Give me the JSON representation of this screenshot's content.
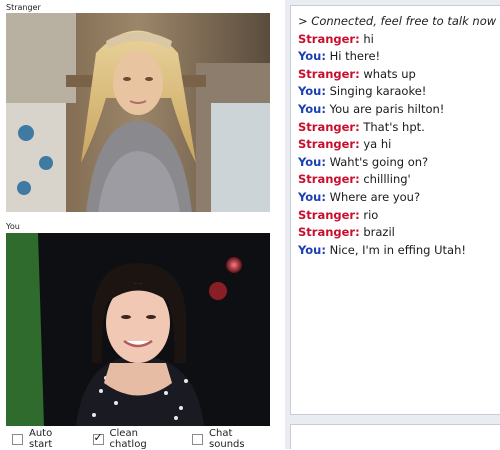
{
  "stranger_video": {
    "label": "Stranger"
  },
  "you_video": {
    "label": "You"
  },
  "options": [
    {
      "label": "Auto start",
      "checked": false
    },
    {
      "label": "Clean chatlog",
      "checked": true
    },
    {
      "label": "Chat sounds",
      "checked": false
    }
  ],
  "chat": {
    "system_message": "> Connected, feel free to talk now",
    "messages": [
      {
        "who": "Stranger:",
        "text": "hi"
      },
      {
        "who": "You:",
        "text": "Hi there!"
      },
      {
        "who": "Stranger:",
        "text": "whats up"
      },
      {
        "who": "You:",
        "text": "Singing karaoke!"
      },
      {
        "who": "You:",
        "text": "You are paris hilton!"
      },
      {
        "who": "Stranger:",
        "text": "That's hpt."
      },
      {
        "who": "Stranger:",
        "text": "ya hi"
      },
      {
        "who": "You:",
        "text": "Waht's going on?"
      },
      {
        "who": "Stranger:",
        "text": "chillling'"
      },
      {
        "who": "You:",
        "text": "Where are you?"
      },
      {
        "who": "Stranger:",
        "text": "rio"
      },
      {
        "who": "Stranger:",
        "text": "brazil"
      },
      {
        "who": "You:",
        "text": "Nice, I'm in effing Utah!"
      }
    ]
  },
  "colors": {
    "stranger_name": "#c8102e",
    "you_name": "#1a3fb2",
    "panel_bg": "#e9ecf1"
  }
}
